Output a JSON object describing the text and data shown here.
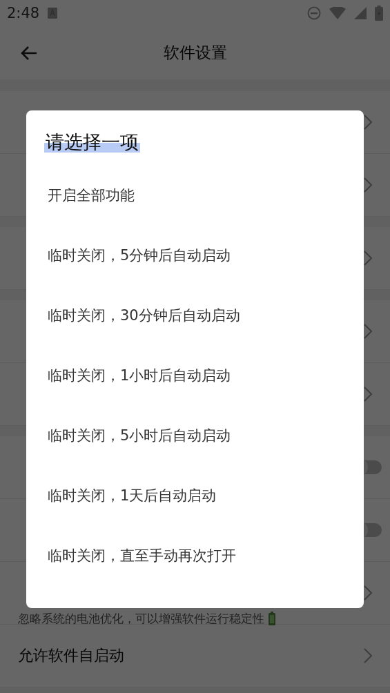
{
  "status_bar": {
    "time": "2:48"
  },
  "app_bar": {
    "title": "软件设置"
  },
  "settings_groups": [
    {
      "rows": [
        {
          "kind": "chevron"
        },
        {
          "kind": "chevron"
        }
      ]
    },
    {
      "rows": [
        {
          "kind": "chevron"
        }
      ]
    },
    {
      "rows": [
        {
          "kind": "chevron"
        },
        {
          "kind": "chevron"
        }
      ]
    },
    {
      "rows": [
        {
          "kind": "toggle",
          "on": false
        },
        {
          "kind": "toggle",
          "on": false
        },
        {
          "kind": "chevron",
          "subtitle": "忽略系统的电池优化，可以增强软件运行稳定性"
        },
        {
          "kind": "chevron",
          "title": "允许软件自启动"
        }
      ]
    }
  ],
  "dialog": {
    "title": "请选择一项",
    "title_selected": true,
    "options": [
      {
        "label": "开启全部功能"
      },
      {
        "label": "临时关闭，5分钟后自动启动"
      },
      {
        "label": "临时关闭，30分钟后自动启动"
      },
      {
        "label": "临时关闭，1小时后自动启动"
      },
      {
        "label": "临时关闭，5小时后自动启动"
      },
      {
        "label": "临时关闭，1天后自动启动"
      },
      {
        "label": "临时关闭，直至手动再次打开"
      }
    ]
  }
}
